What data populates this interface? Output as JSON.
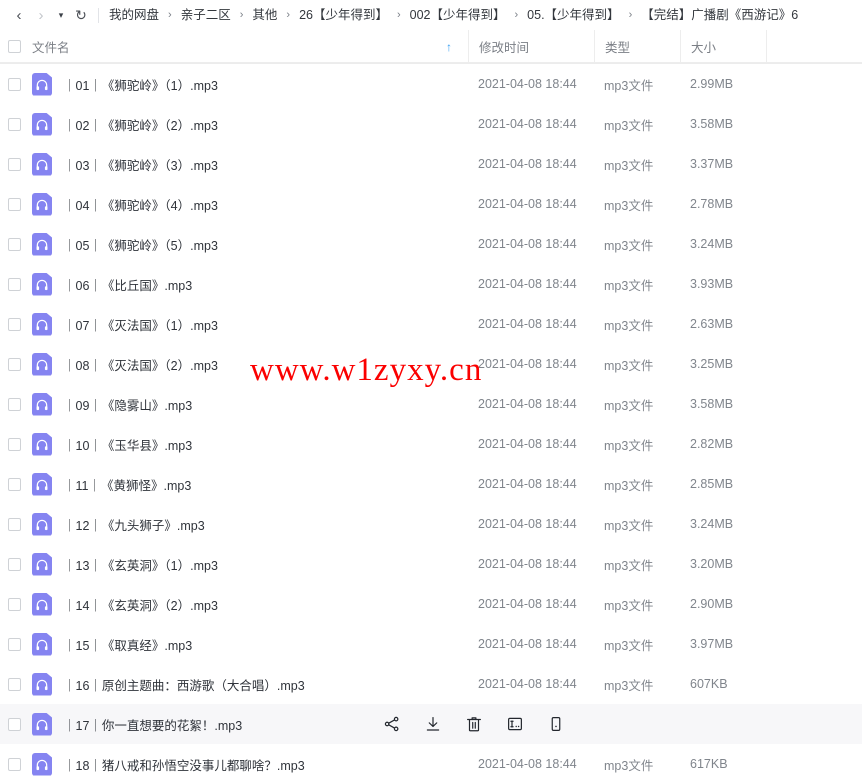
{
  "toolbar": {
    "back_icon": "chevron-left-icon",
    "forward_icon": "chevron-right-icon",
    "history_icon": "caret-down-icon",
    "refresh_icon": "refresh-icon",
    "back_glyph": "‹",
    "forward_glyph": "›",
    "caret_glyph": "▾",
    "refresh_glyph": "↻"
  },
  "breadcrumb": {
    "separator": "›",
    "items": [
      {
        "label": "我的网盘"
      },
      {
        "label": "亲子二区"
      },
      {
        "label": "其他"
      },
      {
        "label": "26【少年得到】"
      },
      {
        "label": "002【少年得到】"
      },
      {
        "label": "05.【少年得到】"
      },
      {
        "label": "【完结】广播剧《西游记》6"
      }
    ]
  },
  "columns": {
    "name": "文件名",
    "modified": "修改时间",
    "type": "类型",
    "size": "大小",
    "sort_arrow": "↑",
    "sort_direction": "asc",
    "accent_color": "#3aa0f2"
  },
  "row_actions": [
    {
      "name": "share-icon",
      "label": "分享"
    },
    {
      "name": "download-icon",
      "label": "下载"
    },
    {
      "name": "delete-icon",
      "label": "删除"
    },
    {
      "name": "rename-icon",
      "label": "重命名"
    },
    {
      "name": "more-icon",
      "label": "更多"
    }
  ],
  "watermark": {
    "text": "www.w1zyxy.cn",
    "color": "#fb0000"
  },
  "files": [
    {
      "name": "｜01｜《狮驼岭》（1）.mp3",
      "modified": "2021-04-08 18:44",
      "type": "mp3文件",
      "size": "2.99MB",
      "icon": "mp3-file-icon",
      "hovered": false
    },
    {
      "name": "｜02｜《狮驼岭》（2）.mp3",
      "modified": "2021-04-08 18:44",
      "type": "mp3文件",
      "size": "3.58MB",
      "icon": "mp3-file-icon",
      "hovered": false
    },
    {
      "name": "｜03｜《狮驼岭》（3）.mp3",
      "modified": "2021-04-08 18:44",
      "type": "mp3文件",
      "size": "3.37MB",
      "icon": "mp3-file-icon",
      "hovered": false
    },
    {
      "name": "｜04｜《狮驼岭》（4）.mp3",
      "modified": "2021-04-08 18:44",
      "type": "mp3文件",
      "size": "2.78MB",
      "icon": "mp3-file-icon",
      "hovered": false
    },
    {
      "name": "｜05｜《狮驼岭》（5）.mp3",
      "modified": "2021-04-08 18:44",
      "type": "mp3文件",
      "size": "3.24MB",
      "icon": "mp3-file-icon",
      "hovered": false
    },
    {
      "name": "｜06｜《比丘国》.mp3",
      "modified": "2021-04-08 18:44",
      "type": "mp3文件",
      "size": "3.93MB",
      "icon": "mp3-file-icon",
      "hovered": false
    },
    {
      "name": "｜07｜《灭法国》（1）.mp3",
      "modified": "2021-04-08 18:44",
      "type": "mp3文件",
      "size": "2.63MB",
      "icon": "mp3-file-icon",
      "hovered": false
    },
    {
      "name": "｜08｜《灭法国》（2）.mp3",
      "modified": "2021-04-08 18:44",
      "type": "mp3文件",
      "size": "3.25MB",
      "icon": "mp3-file-icon",
      "hovered": false
    },
    {
      "name": "｜09｜《隐雾山》.mp3",
      "modified": "2021-04-08 18:44",
      "type": "mp3文件",
      "size": "3.58MB",
      "icon": "mp3-file-icon",
      "hovered": false
    },
    {
      "name": "｜10｜《玉华县》.mp3",
      "modified": "2021-04-08 18:44",
      "type": "mp3文件",
      "size": "2.82MB",
      "icon": "mp3-file-icon",
      "hovered": false
    },
    {
      "name": "｜11｜《黄狮怪》.mp3",
      "modified": "2021-04-08 18:44",
      "type": "mp3文件",
      "size": "2.85MB",
      "icon": "mp3-file-icon",
      "hovered": false
    },
    {
      "name": "｜12｜《九头狮子》.mp3",
      "modified": "2021-04-08 18:44",
      "type": "mp3文件",
      "size": "3.24MB",
      "icon": "mp3-file-icon",
      "hovered": false
    },
    {
      "name": "｜13｜《玄英洞》（1）.mp3",
      "modified": "2021-04-08 18:44",
      "type": "mp3文件",
      "size": "3.20MB",
      "icon": "mp3-file-icon",
      "hovered": false
    },
    {
      "name": "｜14｜《玄英洞》（2）.mp3",
      "modified": "2021-04-08 18:44",
      "type": "mp3文件",
      "size": "2.90MB",
      "icon": "mp3-file-icon",
      "hovered": false
    },
    {
      "name": "｜15｜《取真经》.mp3",
      "modified": "2021-04-08 18:44",
      "type": "mp3文件",
      "size": "3.97MB",
      "icon": "mp3-file-icon",
      "hovered": false
    },
    {
      "name": "｜16｜原创主题曲：西游歌（大合唱）.mp3",
      "modified": "2021-04-08 18:44",
      "type": "mp3文件",
      "size": "607KB",
      "icon": "mp3-file-icon",
      "hovered": false
    },
    {
      "name": "｜17｜你一直想要的花絮！.mp3",
      "modified": "",
      "type": "",
      "size": "",
      "icon": "mp3-file-icon",
      "hovered": true
    },
    {
      "name": "｜18｜猪八戒和孙悟空没事儿都聊啥？.mp3",
      "modified": "2021-04-08 18:44",
      "type": "mp3文件",
      "size": "617KB",
      "icon": "mp3-file-icon",
      "hovered": false
    }
  ]
}
